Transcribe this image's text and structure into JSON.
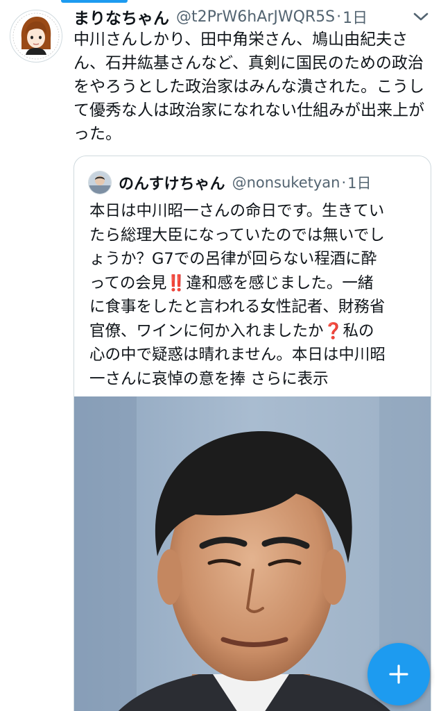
{
  "tweet": {
    "display_name": "まりなちゃん",
    "handle": "@t2PrW6hArJWQR5S",
    "separator": "·",
    "time": "1日",
    "text": "中川さんしかり、田中角栄さん、鳩山由紀夫さん、石井紘基さんなど、真剣に国民のための政治をやろうとした政治家はみんな潰された。こうして優秀な人は政治家になれない仕組みが出来上がった。",
    "avatar_icon": "illustrated-woman-avatar",
    "more_icon": "more-options-icon"
  },
  "quote": {
    "display_name": "のんすけちゃん",
    "handle": "@nonsuketyan",
    "separator": "·",
    "time": "1日",
    "text_lines": [
      "本日は中川昭一さんの命日です。生きてい",
      "たら総理大臣になっていたのでは無いでし",
      "ょうか？G7での呂律が回らない程酒に酔"
    ],
    "line4_before": "っての会見",
    "line4_emoji": "‼️",
    "line4_after": "違和感を感じました。一緒",
    "line5": "に食事をしたと言われる女性記者、財務省",
    "line6_before": "官僚、ワインに何か入れましたか",
    "line6_emoji": "❓",
    "line6_after": "私の",
    "line7": "心の中で疑惑は晴れません。本日は中川昭",
    "line8_before": "一さんに哀悼の意を捧",
    "show_more": "さらに表示",
    "photo_icon": "portrait-photo"
  },
  "fab": {
    "icon": "compose-plus-icon",
    "color": "#1d9bf0"
  },
  "colors": {
    "accent": "#1d9bf0",
    "text_primary": "#0f1419",
    "text_secondary": "#536471",
    "border": "#cfd9de"
  }
}
